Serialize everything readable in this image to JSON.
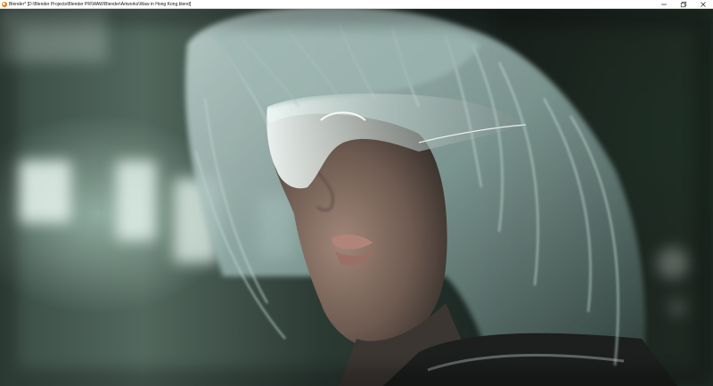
{
  "window": {
    "title": "Blender* [D:\\Blender Projects\\Blender PR\\WAW\\Blender\\Artworks\\Waw in Hong Kong.blend]",
    "app_icon": "blender-logo-icon",
    "controls": {
      "minimize_icon": "minimize-icon",
      "restore_icon": "restore-icon",
      "close_icon": "close-icon"
    }
  },
  "viewport": {
    "content": "rendered-image",
    "colors": {
      "hair": "#a9c1bd",
      "skin": "#8d7669",
      "lips": "#b08479",
      "visor": "#dfe9e6",
      "bokeh": "#e6f5ee"
    }
  }
}
